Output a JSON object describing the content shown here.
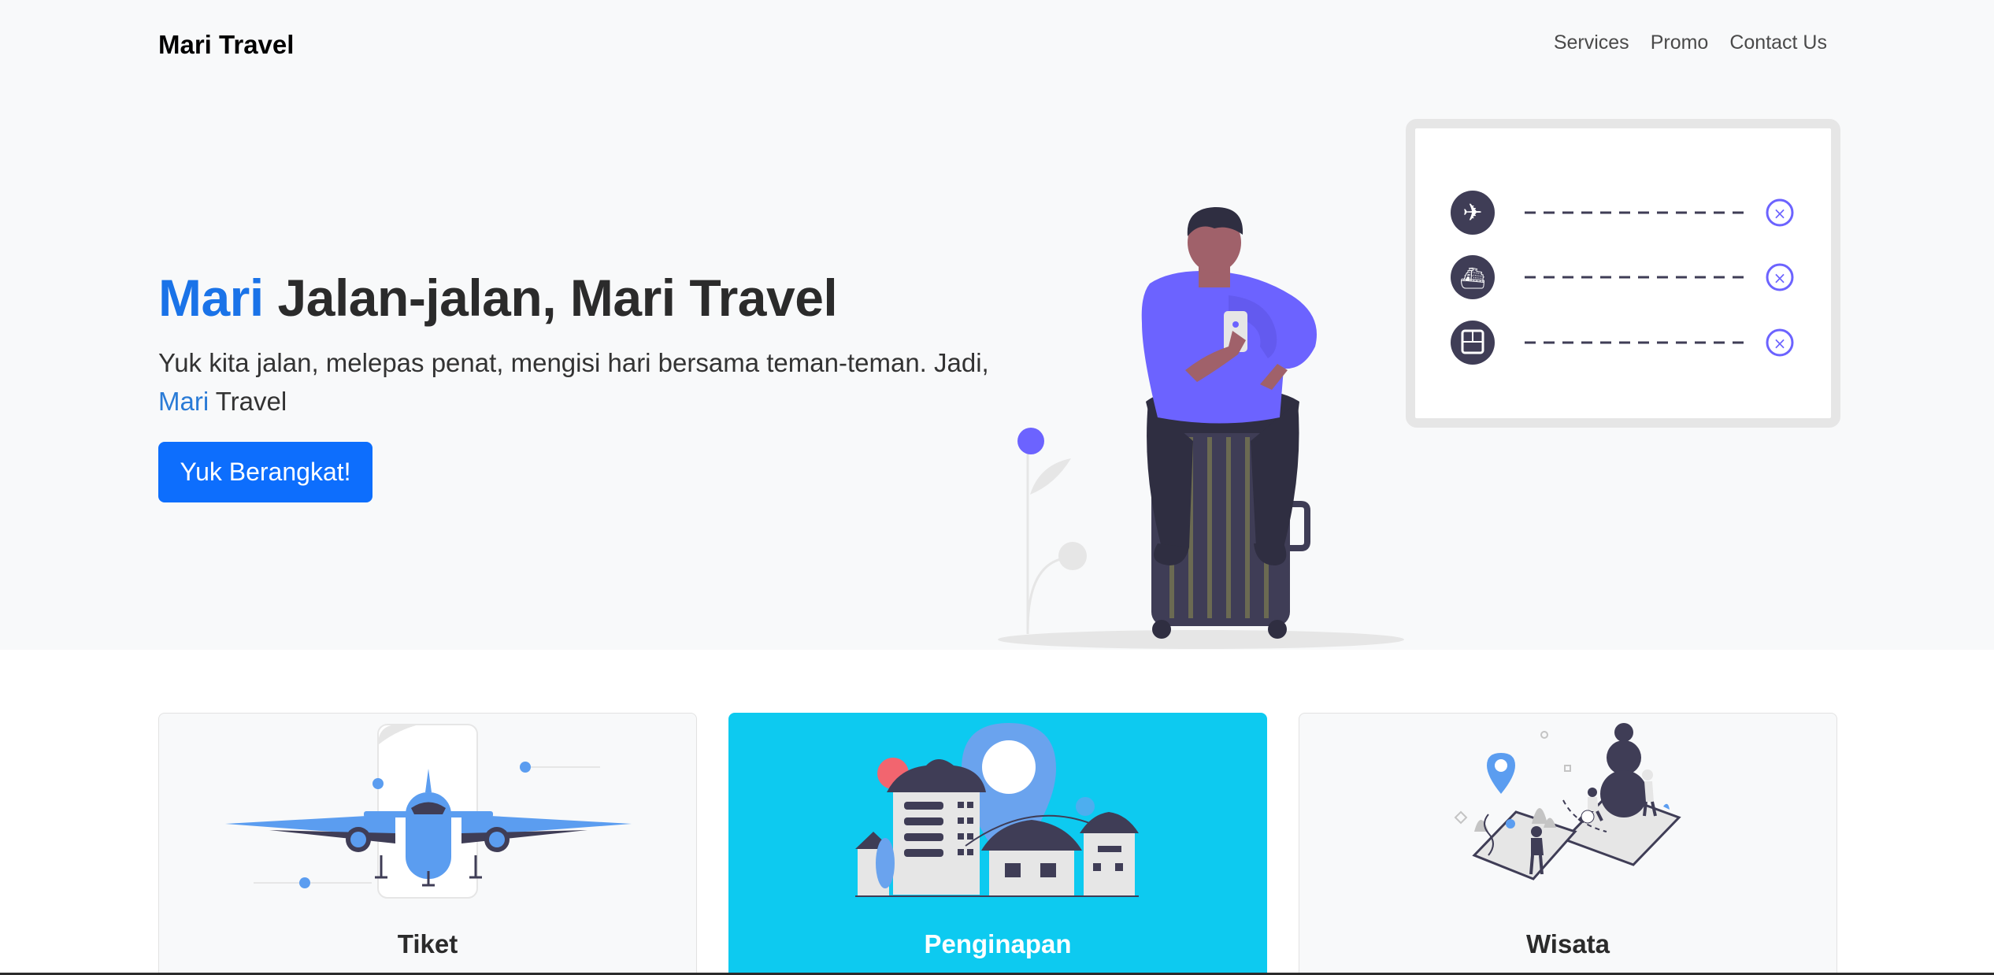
{
  "brand": "Mari Travel",
  "nav": {
    "items": [
      "Services",
      "Promo",
      "Contact Us"
    ]
  },
  "hero": {
    "title_highlight": "Mari",
    "title_rest": " Jalan-jalan, Mari Travel",
    "subtitle_prefix": "Yuk kita jalan, melepas penat, mengisi hari bersama teman-teman. Jadi, ",
    "subtitle_highlight": "Mari",
    "subtitle_suffix": " Travel",
    "cta_label": "Yuk Berangkat!"
  },
  "services": [
    {
      "label": "Tiket",
      "icon": "airplane-illustration",
      "active": false
    },
    {
      "label": "Penginapan",
      "icon": "hotel-illustration",
      "active": true
    },
    {
      "label": "Wisata",
      "icon": "tourism-illustration",
      "active": false
    }
  ],
  "colors": {
    "accent": "#0d6efd",
    "highlight_text": "#1a73e8",
    "active_card": "#0dcaf0",
    "hero_background": "#f8f9fa",
    "illustration_purple": "#6c63ff"
  }
}
